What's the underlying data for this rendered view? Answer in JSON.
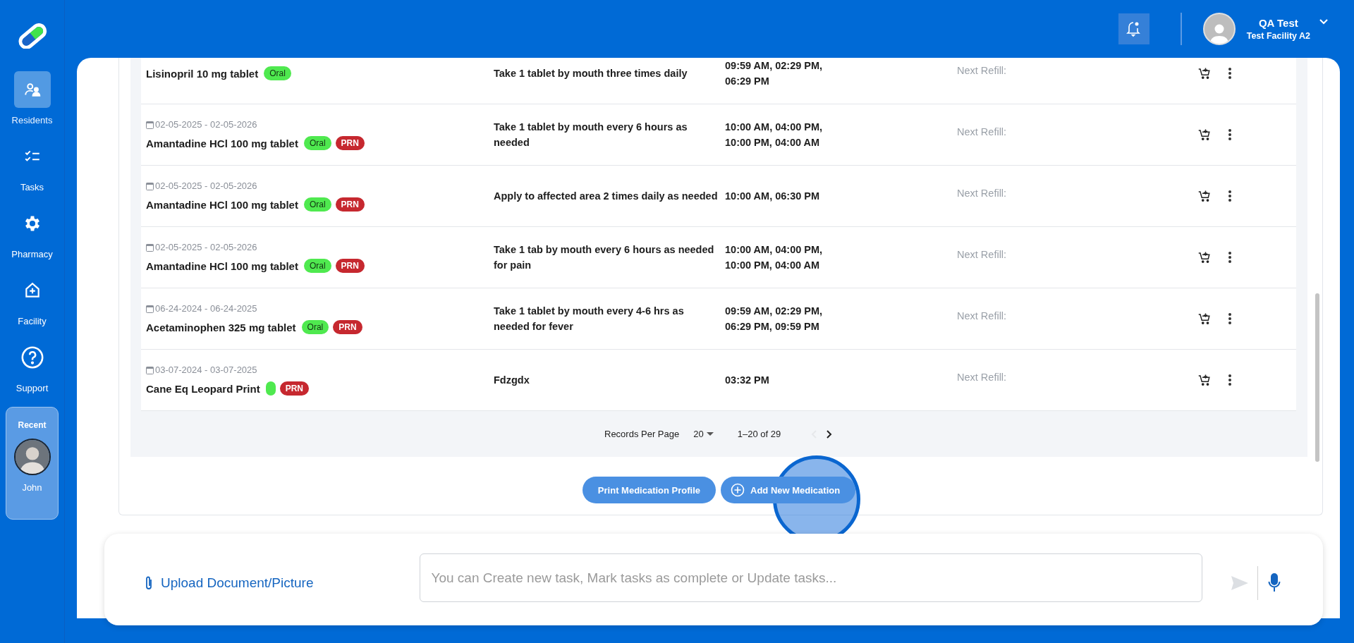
{
  "sidebar": {
    "items": [
      {
        "label": "Residents",
        "selected": true
      },
      {
        "label": "Tasks",
        "selected": false
      },
      {
        "label": "Pharmacy",
        "selected": false
      },
      {
        "label": "Facility",
        "selected": false
      },
      {
        "label": "Support",
        "selected": false
      }
    ],
    "recent": {
      "title": "Recent",
      "name": "John"
    }
  },
  "header": {
    "user": {
      "name": "QA Test",
      "facility": "Test Facility A2"
    }
  },
  "medications": [
    {
      "name": "Lisinopril 10 mg tablet",
      "tags": [
        {
          "kind": "route",
          "label": "Oral"
        }
      ],
      "instructions": "Take 1 tablet by mouth three times daily",
      "times": "09:59 AM, 02:29 PM, 06:29 PM",
      "refill_label": "Next Refill:"
    },
    {
      "dates": "02-05-2025 - 02-05-2026",
      "name": "Amantadine HCl 100 mg tablet",
      "tags": [
        {
          "kind": "route",
          "label": "Oral"
        },
        {
          "kind": "prn",
          "label": "PRN"
        }
      ],
      "instructions": "Take 1 tablet by mouth every 6 hours as needed",
      "times": "10:00 AM, 04:00 PM, 10:00 PM, 04:00 AM",
      "refill_label": "Next Refill:"
    },
    {
      "dates": "02-05-2025 - 02-05-2026",
      "name": "Amantadine HCl 100 mg tablet",
      "tags": [
        {
          "kind": "route",
          "label": "Oral"
        },
        {
          "kind": "prn",
          "label": "PRN"
        }
      ],
      "instructions": "Apply to affected area 2 times daily as needed",
      "times": "10:00 AM, 06:30 PM",
      "refill_label": "Next Refill:"
    },
    {
      "dates": "02-05-2025 - 02-05-2026",
      "name": "Amantadine HCl 100 mg tablet",
      "tags": [
        {
          "kind": "route",
          "label": "Oral"
        },
        {
          "kind": "prn",
          "label": "PRN"
        }
      ],
      "instructions": "Take 1 tab by mouth every 6 hours as needed for pain",
      "times": "10:00 AM, 04:00 PM, 10:00 PM, 04:00 AM",
      "refill_label": "Next Refill:"
    },
    {
      "dates": "06-24-2024 - 06-24-2025",
      "name": "Acetaminophen 325 mg tablet",
      "tags": [
        {
          "kind": "route",
          "label": "Oral"
        },
        {
          "kind": "prn",
          "label": "PRN"
        }
      ],
      "instructions": "Take 1 tablet by mouth every 4-6 hrs as needed for fever",
      "times": "09:59 AM, 02:29 PM, 06:29 PM, 09:59 PM",
      "refill_label": "Next Refill:"
    },
    {
      "dates": "03-07-2024 - 03-07-2025",
      "name": "Cane Eq Leopard Print",
      "tags": [
        {
          "kind": "route"
        },
        {
          "kind": "prn",
          "label": "PRN"
        }
      ],
      "instructions": "Fdzgdx",
      "times": "03:32 PM",
      "refill_label": "Next Refill:"
    }
  ],
  "pagination": {
    "label": "Records Per Page",
    "per_page": "20",
    "range": "1–20 of 29",
    "previous": {
      "disabled": true
    },
    "next": {
      "disabled": false
    }
  },
  "buttons": [
    "Print Medication Profile",
    "Add New Medication"
  ],
  "chat": {
    "upload_label": "Upload Document/Picture",
    "placeholder": "You can Create new task, Mark tasks as complete or Update tasks..."
  }
}
